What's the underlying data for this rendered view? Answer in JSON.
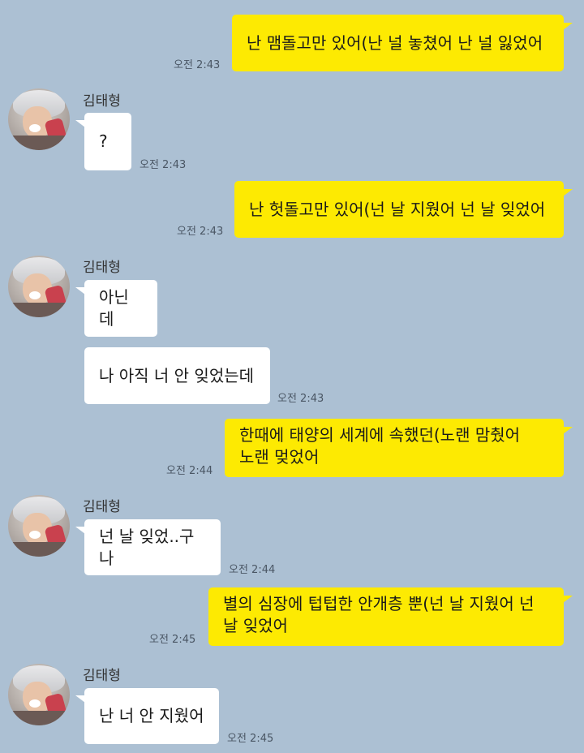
{
  "contact": {
    "name": "김태형"
  },
  "messages": [
    {
      "text": "난 맴돌고만 있어(난 널 놓쳤어 난 널 잃었어",
      "time": "오전 2:43"
    },
    {
      "text": "?",
      "time": "오전 2:43"
    },
    {
      "text": "난 헛돌고만 있어(넌 날 지웠어 넌 날 잊었어",
      "time": "오전 2:43"
    },
    {
      "text": "아닌데"
    },
    {
      "text": "나 아직 너 안 잊었는데",
      "time": "오전 2:43"
    },
    {
      "line1": "한때에 태양의 세계에 속했던(노랜 맘췄어",
      "line2": "노랜 멎었어",
      "time": "오전 2:44"
    },
    {
      "text": "넌 날 잊었..구나",
      "time": "오전 2:44"
    },
    {
      "line1": "별의 심장에 텁텁한 안개층 뿐(넌 날 지웠어 넌",
      "line2": "날 잊었어",
      "time": "오전 2:45"
    },
    {
      "text": "난 너 안 지웠어",
      "time": "오전 2:45"
    }
  ],
  "colors": {
    "background": "#acc0d3",
    "outgoing_bubble": "#fdea02",
    "incoming_bubble": "#ffffff"
  }
}
